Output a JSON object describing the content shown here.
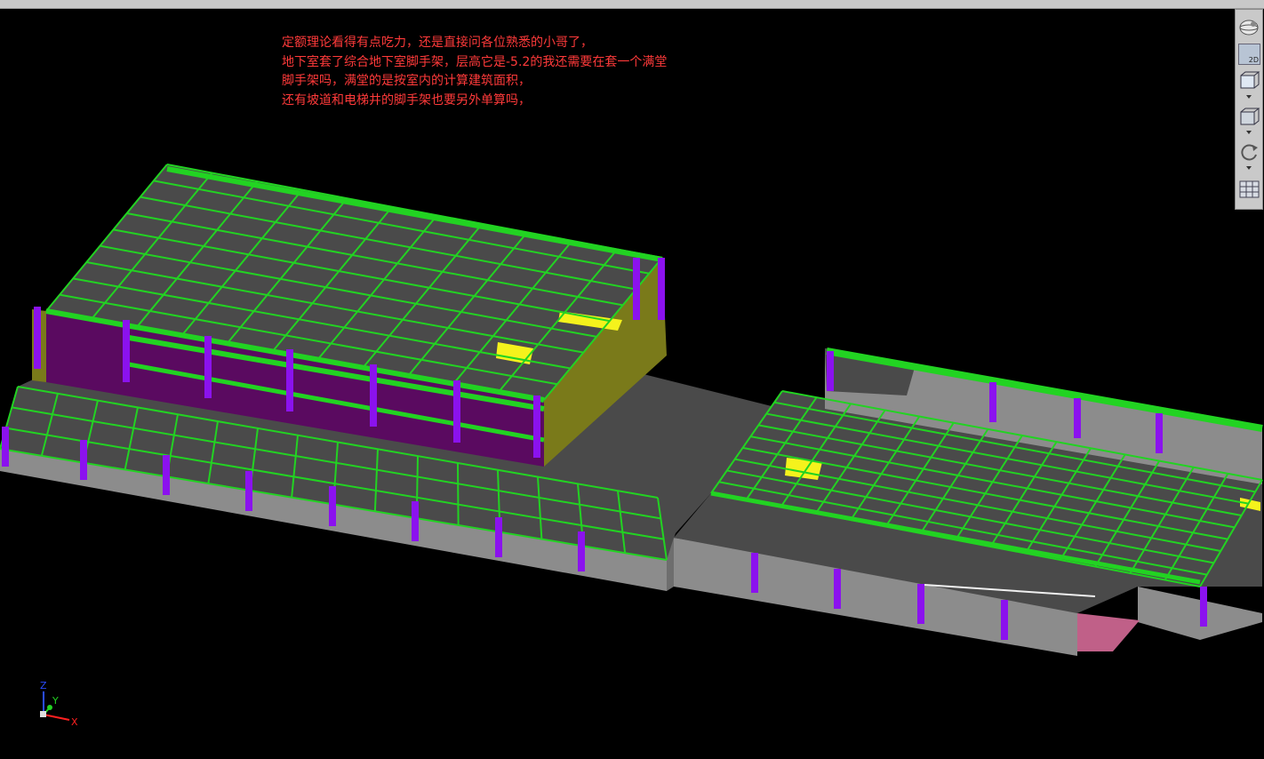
{
  "note": {
    "lines": [
      "定额理论看得有点吃力，还是直接问各位熟悉的小哥了，",
      "地下室套了综合地下室脚手架，层高它是-5.2的我还需要在套一个满堂",
      "脚手架吗，满堂的是按室内的计算建筑面积，",
      "还有坡道和电梯井的脚手架也要另外单算吗，"
    ],
    "color": "#ff3a3a"
  },
  "toolbar": {
    "dim_label": "2D",
    "buttons": [
      "orbit-icon",
      "view-2d-icon",
      "box-view-icon",
      "box-wire-icon",
      "rotate-icon",
      "layer-grid-icon"
    ]
  },
  "axis": {
    "z": "Z",
    "y": "Y",
    "x": "X"
  },
  "colors": {
    "slab": "#4a4a4a",
    "wall": "#8c8c8c",
    "beam": "#22d322",
    "column": "#8b12ee",
    "openwall": "#5a0a60",
    "shear": "#7a7a1a",
    "highlight": "#f5f21c",
    "ramp": "#c06088"
  }
}
